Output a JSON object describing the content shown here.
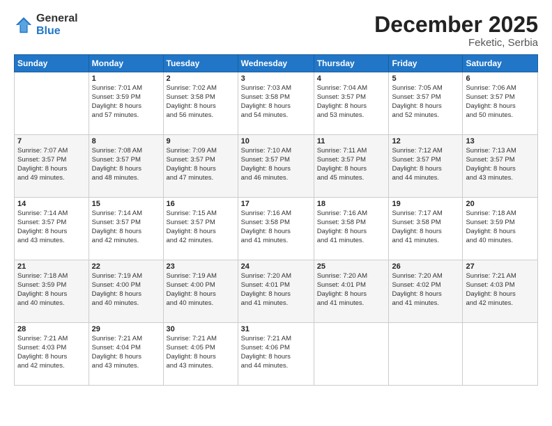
{
  "logo": {
    "general": "General",
    "blue": "Blue"
  },
  "header": {
    "month": "December 2025",
    "location": "Feketic, Serbia"
  },
  "days_of_week": [
    "Sunday",
    "Monday",
    "Tuesday",
    "Wednesday",
    "Thursday",
    "Friday",
    "Saturday"
  ],
  "weeks": [
    [
      {
        "num": "",
        "info": ""
      },
      {
        "num": "1",
        "info": "Sunrise: 7:01 AM\nSunset: 3:59 PM\nDaylight: 8 hours\nand 57 minutes."
      },
      {
        "num": "2",
        "info": "Sunrise: 7:02 AM\nSunset: 3:58 PM\nDaylight: 8 hours\nand 56 minutes."
      },
      {
        "num": "3",
        "info": "Sunrise: 7:03 AM\nSunset: 3:58 PM\nDaylight: 8 hours\nand 54 minutes."
      },
      {
        "num": "4",
        "info": "Sunrise: 7:04 AM\nSunset: 3:57 PM\nDaylight: 8 hours\nand 53 minutes."
      },
      {
        "num": "5",
        "info": "Sunrise: 7:05 AM\nSunset: 3:57 PM\nDaylight: 8 hours\nand 52 minutes."
      },
      {
        "num": "6",
        "info": "Sunrise: 7:06 AM\nSunset: 3:57 PM\nDaylight: 8 hours\nand 50 minutes."
      }
    ],
    [
      {
        "num": "7",
        "info": "Sunrise: 7:07 AM\nSunset: 3:57 PM\nDaylight: 8 hours\nand 49 minutes."
      },
      {
        "num": "8",
        "info": "Sunrise: 7:08 AM\nSunset: 3:57 PM\nDaylight: 8 hours\nand 48 minutes."
      },
      {
        "num": "9",
        "info": "Sunrise: 7:09 AM\nSunset: 3:57 PM\nDaylight: 8 hours\nand 47 minutes."
      },
      {
        "num": "10",
        "info": "Sunrise: 7:10 AM\nSunset: 3:57 PM\nDaylight: 8 hours\nand 46 minutes."
      },
      {
        "num": "11",
        "info": "Sunrise: 7:11 AM\nSunset: 3:57 PM\nDaylight: 8 hours\nand 45 minutes."
      },
      {
        "num": "12",
        "info": "Sunrise: 7:12 AM\nSunset: 3:57 PM\nDaylight: 8 hours\nand 44 minutes."
      },
      {
        "num": "13",
        "info": "Sunrise: 7:13 AM\nSunset: 3:57 PM\nDaylight: 8 hours\nand 43 minutes."
      }
    ],
    [
      {
        "num": "14",
        "info": "Sunrise: 7:14 AM\nSunset: 3:57 PM\nDaylight: 8 hours\nand 43 minutes."
      },
      {
        "num": "15",
        "info": "Sunrise: 7:14 AM\nSunset: 3:57 PM\nDaylight: 8 hours\nand 42 minutes."
      },
      {
        "num": "16",
        "info": "Sunrise: 7:15 AM\nSunset: 3:57 PM\nDaylight: 8 hours\nand 42 minutes."
      },
      {
        "num": "17",
        "info": "Sunrise: 7:16 AM\nSunset: 3:58 PM\nDaylight: 8 hours\nand 41 minutes."
      },
      {
        "num": "18",
        "info": "Sunrise: 7:16 AM\nSunset: 3:58 PM\nDaylight: 8 hours\nand 41 minutes."
      },
      {
        "num": "19",
        "info": "Sunrise: 7:17 AM\nSunset: 3:58 PM\nDaylight: 8 hours\nand 41 minutes."
      },
      {
        "num": "20",
        "info": "Sunrise: 7:18 AM\nSunset: 3:59 PM\nDaylight: 8 hours\nand 40 minutes."
      }
    ],
    [
      {
        "num": "21",
        "info": "Sunrise: 7:18 AM\nSunset: 3:59 PM\nDaylight: 8 hours\nand 40 minutes."
      },
      {
        "num": "22",
        "info": "Sunrise: 7:19 AM\nSunset: 4:00 PM\nDaylight: 8 hours\nand 40 minutes."
      },
      {
        "num": "23",
        "info": "Sunrise: 7:19 AM\nSunset: 4:00 PM\nDaylight: 8 hours\nand 40 minutes."
      },
      {
        "num": "24",
        "info": "Sunrise: 7:20 AM\nSunset: 4:01 PM\nDaylight: 8 hours\nand 41 minutes."
      },
      {
        "num": "25",
        "info": "Sunrise: 7:20 AM\nSunset: 4:01 PM\nDaylight: 8 hours\nand 41 minutes."
      },
      {
        "num": "26",
        "info": "Sunrise: 7:20 AM\nSunset: 4:02 PM\nDaylight: 8 hours\nand 41 minutes."
      },
      {
        "num": "27",
        "info": "Sunrise: 7:21 AM\nSunset: 4:03 PM\nDaylight: 8 hours\nand 42 minutes."
      }
    ],
    [
      {
        "num": "28",
        "info": "Sunrise: 7:21 AM\nSunset: 4:03 PM\nDaylight: 8 hours\nand 42 minutes."
      },
      {
        "num": "29",
        "info": "Sunrise: 7:21 AM\nSunset: 4:04 PM\nDaylight: 8 hours\nand 43 minutes."
      },
      {
        "num": "30",
        "info": "Sunrise: 7:21 AM\nSunset: 4:05 PM\nDaylight: 8 hours\nand 43 minutes."
      },
      {
        "num": "31",
        "info": "Sunrise: 7:21 AM\nSunset: 4:06 PM\nDaylight: 8 hours\nand 44 minutes."
      },
      {
        "num": "",
        "info": ""
      },
      {
        "num": "",
        "info": ""
      },
      {
        "num": "",
        "info": ""
      }
    ]
  ]
}
